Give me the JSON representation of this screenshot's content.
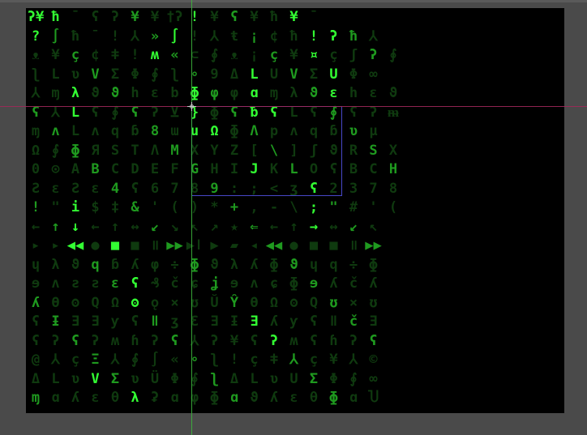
{
  "colors": {
    "background": "#000000",
    "frame": "#4a4a4a",
    "glyph_bright": "#33ff33",
    "glyph_mid": "#1f9a1f",
    "glyph_dim": "#0f3a0f",
    "guide_horizontal": "#a0285a",
    "guide_vertical": "#3cb43c",
    "selection": "#4848c8"
  },
  "glyph_rows": [
    "ʔ¥   ħ   ¯  ʕ  ʔ  ¥  ¥   †ʔ  !  ¥  ʕ  ¥ ħ  ¥  ¯",
    "?  ∫  ħ ¯  !  ⅄  »  ∫ !  ⅄  ŧ  ¡  ¢  ħ  !  ʔ  ħ   ⅄",
    "ᴥ  ¥ ç  ¢  ǂ ! ʍ  «  ⊂  ∮  ᴥ   ¡  ç  ¥ ¤  ç  ʃ ʔ  ∮",
    "ʅ  L  ʋ  V  Σ  Φ  ∮  ʅ  ∘  9  Δ  L  U   V  Σ  U  Φ  ∞",
    "⅄  ɱ  λ  ϑ  ϑ  h  ɛ  b  ɸ  φ  φ  ɑ  ɱ  λ  ϑ  ε  h  ɛ  ϑ",
    "ʕ  ⅄  L  ʕ  ∮  ʕ  ʔ  ⊻  }  ɸ  ʕ  ƀ  ʕ  L  ʕ  ∮  ʕ  ʔ  ᵯ",
    "ɱ  ʌ  L  ʌ  q  ɓ  8  ɯ  u  Ω  ɸ  Λ  p  ʌ  q  ɓ  ʋ  μ",
    "Ω  ∮  ɸ  Я  S  T  Λ  M  X  Y  Z  [  \\  ]  ʃ  ϑ  R  S  X",
    "0  ⊙  A  B  C  D  E  F  G  H  I  J  K  L  O  ʕ  B  C  H",
    "Ƨ  ε  Ƨ  ɛ  4  ʕ  6  7  8  9  :  ;  <  ʒ  ʕ  2  3  7  8",
    "!  \"  i  $  ‡  &  '  (  )  *  +  ,  -  \\  ;  \"  #  '  (",
    "←  ↑  ↓  ←  ↑  ↔  ↙  ↘  ↖  ↗  ★  ⇐  ←  ↑  →  ↔  ↙  ↖",
    "▸  ▸  ◀◀  ●  ■  ■  ॥  ▶▶  ▶ǀ  ▶  ▰  ◂  ◀◀  ●  ■  ■  ॥  ▶▶",
    "ɥ  λ  ϑ  q  ɓ  ʎ  φ  ÷  ɸ  ϑ  λ  ʎ  ɸ  ϑ  ɥ  q  ÷  ɸ",
    "ɘ  ʌ  ƨ  ƨ  ɛ  ʕ  ₰  č  ɕ  ʝ  ɘ  ʌ  ɕ  ɸ  ɘ  ʎ  č  ʎ",
    "ʎ  Ɵ  ʘ  Q  Ω  ʘ  ǫ  ×  ʊ  Ŭ  Ŷ  Ɵ  Ω  ʘ  Q  ʊ  ×  ʊ",
    "ʕ  Ɨ  Ǝ  Ǝ  ƴ  ʕ  ǁ  ʒ  Ɛ  Ǝ  Ɨ  Ǝ  ʎ  ƴ  ʕ  ǁ  č  Ǝ",
    "ʕ  ʔ  ʕ  ʔ  ʍ  ɦ  ʔ  ʕ  ⅄  ʔ  ¥  ʕ  ʔ  ʍ  ʕ  ɦ  ʔ  ʕ",
    "@  ⅄  ç  Ξ  ⅄  ∮  ∫  «  ∘  ʅ  !  ç  ǂ  ⅄  ç  ¥  ⅄  ©",
    "Δ  L  ʋ  V  Σ  ʋ  Ü  Φ  ∮  ʅ  Δ  L  ʋ  U  Σ  Φ  ∮  ∞",
    "ɱ  ɑ  ʎ  ɛ  θ  λ  ʡ  ɑ  φ  ɸ  ɑ  ϑ  ʎ  ɛ  θ  ɸ  ɑ  Ⴎ"
  ],
  "bright_cells": [
    [
      0,
      0
    ],
    [
      0,
      1
    ],
    [
      0,
      8
    ],
    [
      0,
      13
    ],
    [
      1,
      0
    ],
    [
      1,
      7
    ],
    [
      1,
      14
    ],
    [
      1,
      15
    ],
    [
      2,
      6
    ],
    [
      2,
      14
    ],
    [
      3,
      11
    ],
    [
      3,
      15
    ],
    [
      4,
      2
    ],
    [
      4,
      8
    ],
    [
      4,
      11
    ],
    [
      4,
      15
    ],
    [
      5,
      2
    ],
    [
      5,
      8
    ],
    [
      5,
      11
    ],
    [
      5,
      12
    ],
    [
      6,
      8
    ],
    [
      6,
      9
    ],
    [
      8,
      11
    ],
    [
      9,
      14
    ],
    [
      10,
      2
    ],
    [
      10,
      14
    ],
    [
      11,
      2
    ],
    [
      11,
      14
    ],
    [
      12,
      2
    ],
    [
      12,
      4
    ],
    [
      14,
      5
    ],
    [
      15,
      5
    ],
    [
      16,
      11
    ],
    [
      17,
      12
    ],
    [
      19,
      3
    ],
    [
      20,
      5
    ]
  ]
}
